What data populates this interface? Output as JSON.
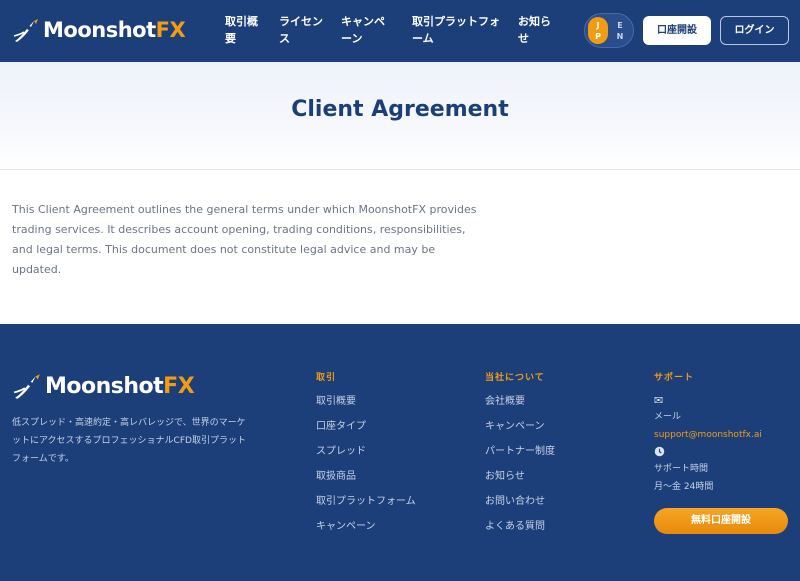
{
  "brand": {
    "name_white": "Moonshot",
    "name_accent": "FX",
    "accent_color": "#f39c12",
    "primary_color": "#1c3f7a",
    "icon": "rocket-icon"
  },
  "header": {
    "nav": [
      {
        "line1": "取引概",
        "line2": "要"
      },
      {
        "line1": "ライセン",
        "line2": "ス"
      },
      {
        "line1": "キャンペ",
        "line2": "ーン"
      },
      {
        "line1": "取引プラットフォ",
        "line2": "ーム"
      },
      {
        "line1": "お知ら",
        "line2": "せ"
      }
    ],
    "lang": {
      "jp": [
        "J",
        "P"
      ],
      "en": [
        "E",
        "N"
      ]
    },
    "open_account": "口座開設",
    "login": "ログイン"
  },
  "hero": {
    "title": "Client Agreement"
  },
  "intro": "This Client Agreement outlines the general terms under which MoonshotFX provides trading services. It describes account opening, trading conditions, responsibilities, and legal terms. This document does not constitute legal advice and may be updated.",
  "footer": {
    "description": "低スプレッド・高速約定・高レバレッジで、世界のマーケットにアクセスするプロフェッショナルCFD取引プラットフォームです。",
    "trading": {
      "title": "取引",
      "items": [
        "取引概要",
        "口座タイプ",
        "スプレッド",
        "取扱商品",
        "取引プラットフォーム",
        "キャンペーン"
      ]
    },
    "company": {
      "title": "当社について",
      "items": [
        "会社概要",
        "キャンペーン",
        "パートナー制度",
        "お知らせ",
        "お問い合わせ",
        "よくある質問"
      ]
    },
    "support": {
      "title": "サポート",
      "mail_icon": "envelope-icon",
      "mail_label": "メール",
      "email": "support@moonshotfx.ai",
      "clock_icon": "clock-icon",
      "hours_label": "サポート時間",
      "hours": "月〜金 24時間",
      "cta": "無料口座開設"
    }
  }
}
